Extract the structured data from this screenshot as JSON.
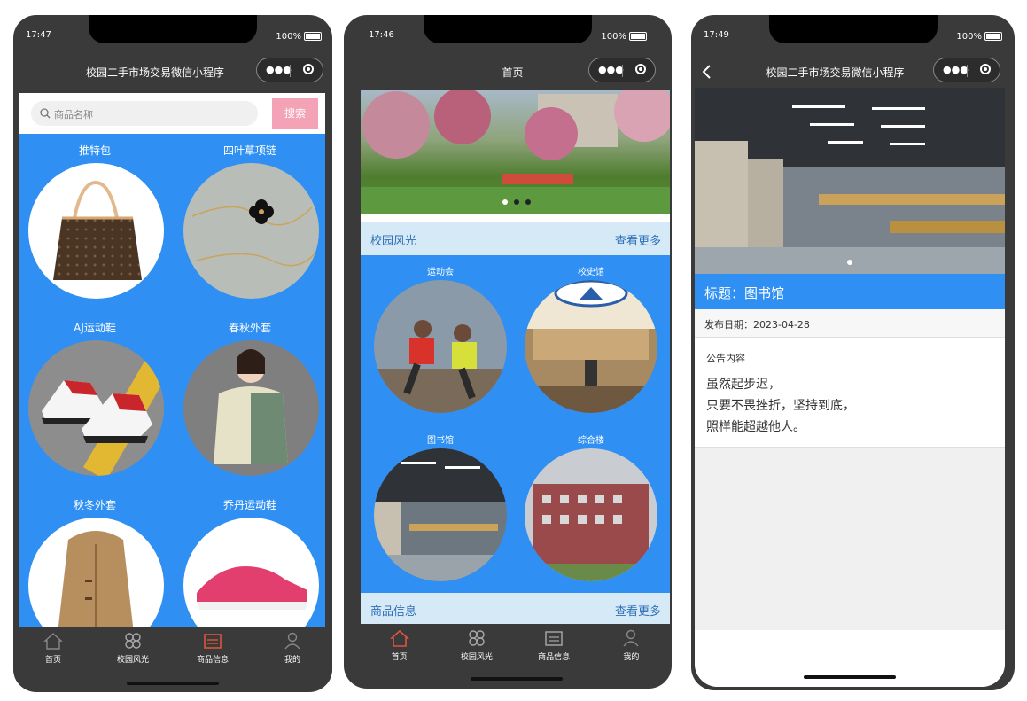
{
  "phone1": {
    "time": "17:47",
    "battery": "100%",
    "nav_title": "校园二手市场交易微信小程序",
    "search_placeholder": "商品名称",
    "search_button": "搜索",
    "products": [
      "推特包",
      "四叶草项链",
      "AJ运动鞋",
      "春秋外套",
      "秋冬外套",
      "乔丹运动鞋"
    ],
    "tabs": [
      "首页",
      "校园风光",
      "商品信息",
      "我的"
    ]
  },
  "phone2": {
    "time": "17:46",
    "battery": "100%",
    "nav_title": "首页",
    "section1_title": "校园风光",
    "section1_more": "查看更多",
    "scenery": [
      "运动会",
      "校史馆",
      "图书馆",
      "综合楼"
    ],
    "section2_title": "商品信息",
    "section2_more": "查看更多",
    "tabs": [
      "首页",
      "校园风光",
      "商品信息",
      "我的"
    ]
  },
  "phone3": {
    "time": "17:49",
    "battery": "100%",
    "nav_title": "校园二手市场交易微信小程序",
    "title_label": "标题：图书馆",
    "date_label": "发布日期：2023-04-28",
    "content_label": "公告内容",
    "content_lines": [
      "虽然起步迟，",
      "只要不畏挫折，坚持到底，",
      "照样能超越他人。"
    ]
  },
  "colors": {
    "accent_blue": "#2f8ff2",
    "search_pink": "#f3a3b5",
    "active_tab": "#e0533d",
    "section_bg": "#d6e9f7"
  }
}
